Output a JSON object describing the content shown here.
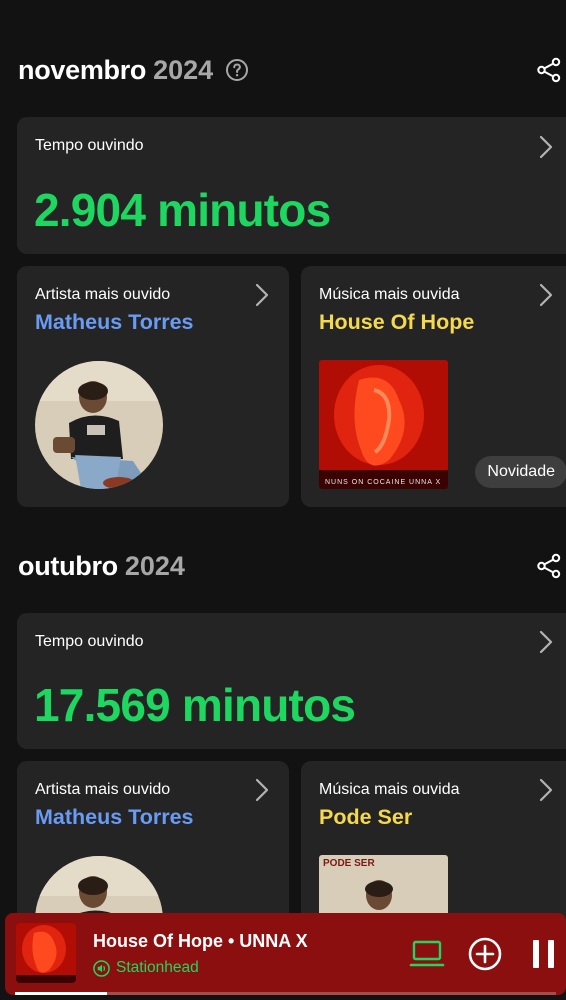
{
  "months": [
    {
      "name": "novembro",
      "year": "2024",
      "listening": {
        "label": "Tempo ouvindo",
        "value": "2.904 minutos"
      },
      "top_artist": {
        "label": "Artista mais ouvido",
        "name": "Matheus Torres"
      },
      "top_song": {
        "label": "Música mais ouvida",
        "name": "House Of Hope",
        "badge": "Novidade",
        "cover_caption": "NUNS ON COCAINE   UNNA X"
      }
    },
    {
      "name": "outubro",
      "year": "2024",
      "listening": {
        "label": "Tempo ouvindo",
        "value": "17.569 minutos"
      },
      "top_artist": {
        "label": "Artista mais ouvido",
        "name": "Matheus Torres"
      },
      "top_song": {
        "label": "Música mais ouvida",
        "name": "Pode Ser",
        "cover_caption": "PODE SER"
      }
    }
  ],
  "player": {
    "title": "House Of Hope • UNNA X",
    "device": "Stationhead",
    "progress": 0.17,
    "icons": [
      "laptop-icon",
      "add-circle-icon",
      "pause-icon"
    ]
  },
  "colors": {
    "accent_green": "#1ed760",
    "artist_blue": "#6a9bf4",
    "song_yellow": "#f5d84b",
    "player_bg": "#8b0f0f",
    "card_bg": "#242424"
  }
}
